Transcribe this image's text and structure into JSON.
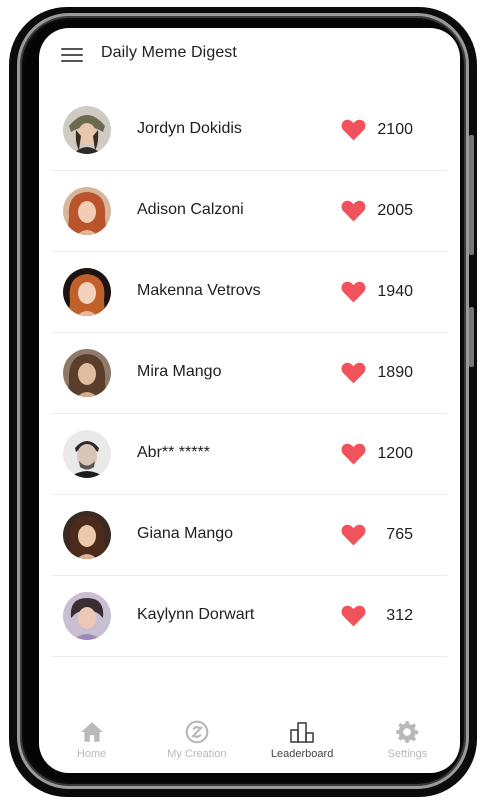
{
  "header": {
    "title": "Daily Meme Digest",
    "menu_icon": "hamburger-menu-icon"
  },
  "colors": {
    "heart": "#f0535b",
    "active_nav": "#444444",
    "inactive_nav": "#b9b9b9"
  },
  "leaderboard": [
    {
      "name": "Jordyn Dokidis",
      "score": "2100"
    },
    {
      "name": "Adison Calzoni",
      "score": "2005"
    },
    {
      "name": "Makenna Vetrovs",
      "score": "1940"
    },
    {
      "name": "Mira Mango",
      "score": "1890"
    },
    {
      "name": "Abr** *****",
      "score": "1200"
    },
    {
      "name": "Giana Mango",
      "score": "765"
    },
    {
      "name": "Kaylynn Dorwart",
      "score": "312"
    }
  ],
  "nav": {
    "items": [
      {
        "label": "Home",
        "icon": "home-icon"
      },
      {
        "label": "My Creation",
        "icon": "creation-icon"
      },
      {
        "label": "Leaderboard",
        "icon": "leaderboard-icon",
        "active": true
      },
      {
        "label": "Settings",
        "icon": "gear-icon"
      }
    ]
  }
}
